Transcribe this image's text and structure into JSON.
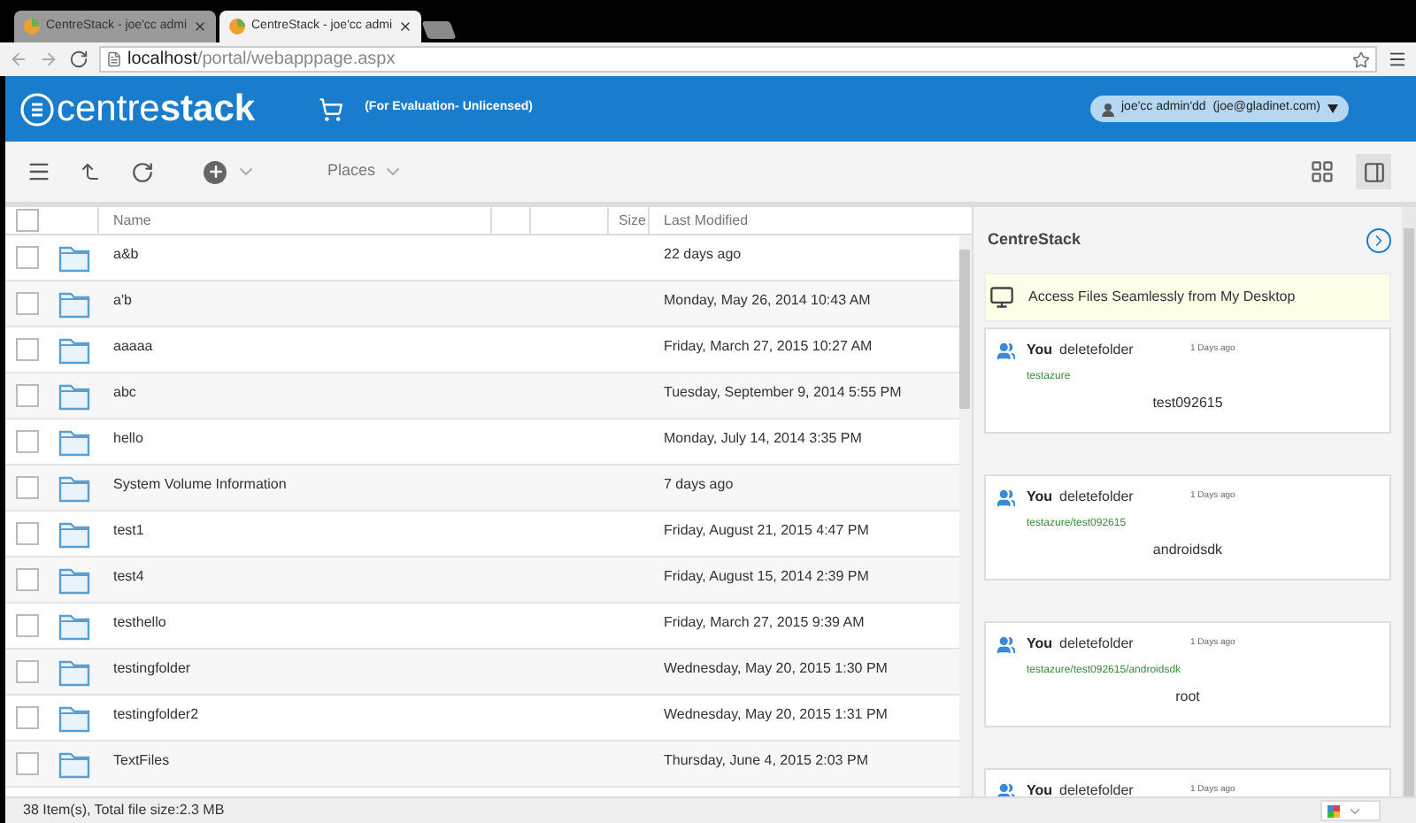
{
  "browser": {
    "tabs": [
      {
        "title": "CentreStack - joe'cc admi",
        "selected": false
      },
      {
        "title": "CentreStack - joe'cc admi",
        "selected": true
      }
    ],
    "url_host": "localhost",
    "url_path": "/portal/webapppage.aspx"
  },
  "header": {
    "logo": "centre**stack**",
    "license": "(For Evaluation- Unlicensed)",
    "user": "joe'cc admin'dd  (joe@gladinet.com)"
  },
  "toolbar": {
    "places": "Places"
  },
  "table": {
    "columns": [
      "Name",
      "Size",
      "Last Modified"
    ],
    "header_checked": false,
    "rows": [
      {
        "name": "a&b",
        "modified": "22 days ago",
        "checked": false
      },
      {
        "name": "a'b",
        "modified": "Monday, May 26, 2014 10:43 AM",
        "checked": false
      },
      {
        "name": "aaaaa",
        "modified": "Friday, March 27, 2015 10:27 AM",
        "checked": false
      },
      {
        "name": "abc",
        "modified": "Tuesday, September 9, 2014 5:55 PM",
        "checked": false
      },
      {
        "name": "hello",
        "modified": "Monday, July 14, 2014 3:35 PM",
        "checked": false
      },
      {
        "name": "System Volume Information",
        "modified": "7 days ago",
        "checked": false
      },
      {
        "name": "test1",
        "modified": "Friday, August 21, 2015 4:47 PM",
        "checked": false
      },
      {
        "name": "test4",
        "modified": "Friday, August 15, 2014 2:39 PM",
        "checked": false
      },
      {
        "name": "testhello",
        "modified": "Friday, March 27, 2015 9:39 AM",
        "checked": false
      },
      {
        "name": "testingfolder",
        "modified": "Wednesday, May 20, 2015 1:30 PM",
        "checked": false
      },
      {
        "name": "testingfolder2",
        "modified": "Wednesday, May 20, 2015 1:31 PM",
        "checked": false
      },
      {
        "name": "TextFiles",
        "modified": "Thursday, June 4, 2015 2:03 PM",
        "checked": false
      }
    ]
  },
  "panel": {
    "title": "CentreStack",
    "banner": "Access Files Seamlessly from My Desktop",
    "activities": [
      {
        "user": "You",
        "action": "deletefolder",
        "time": "1 Days ago",
        "path": "testazure",
        "item": "test092615"
      },
      {
        "user": "You",
        "action": "deletefolder",
        "time": "1 Days ago",
        "path": "testazure/test092615",
        "item": "androidsdk"
      },
      {
        "user": "You",
        "action": "deletefolder",
        "time": "1 Days ago",
        "path": "testazure/test092615/androidsdk",
        "item": "root"
      },
      {
        "user": "You",
        "action": "deletefolder",
        "time": "1 Days ago"
      }
    ]
  },
  "status_bar": {
    "summary": "38 Item(s), Total file size:2.3 MB"
  }
}
